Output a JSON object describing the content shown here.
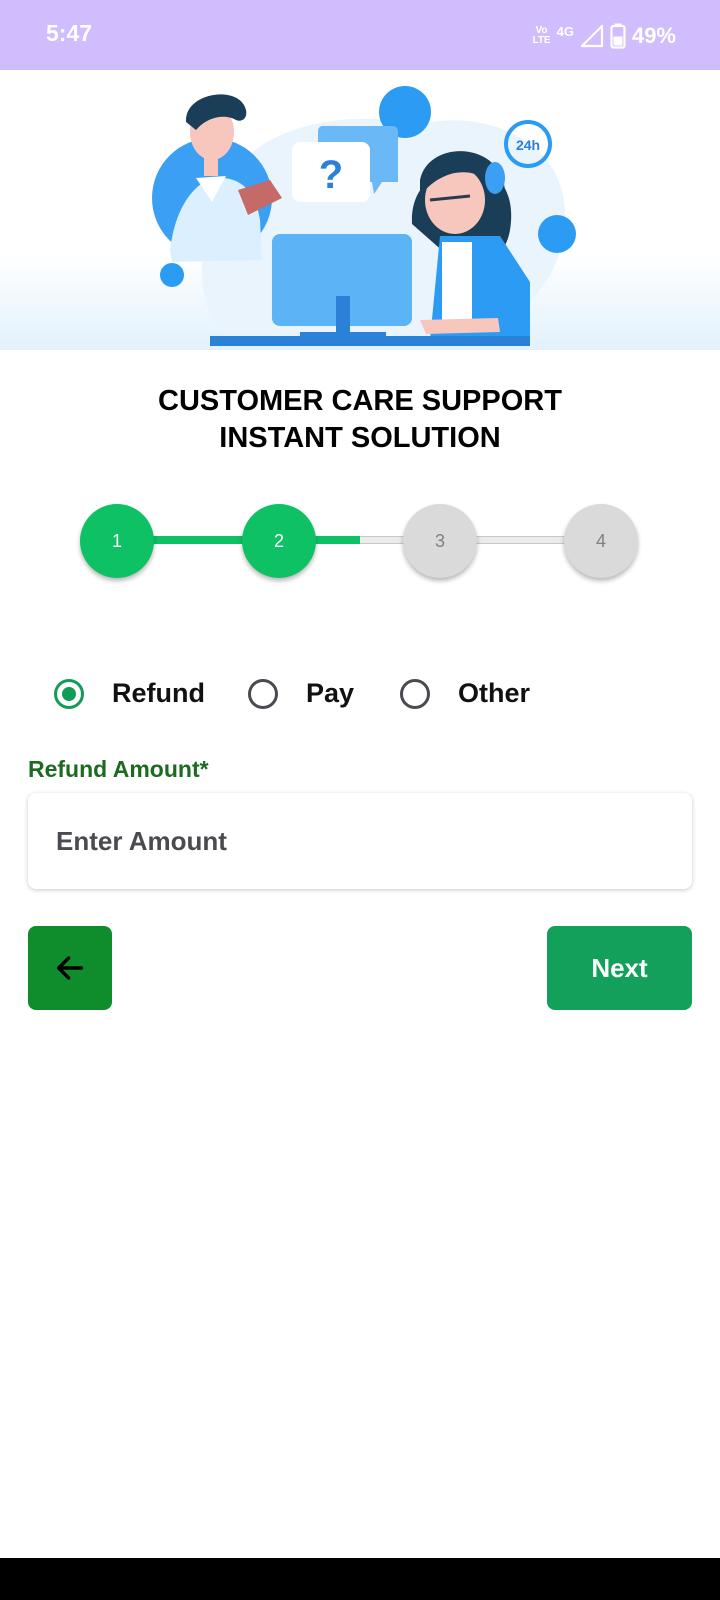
{
  "status": {
    "time": "5:47",
    "volte_top": "Vo",
    "volte_bottom": "LTE",
    "network": "4G",
    "battery": "49%"
  },
  "header": {
    "title_line1": "CUSTOMER CARE SUPPORT",
    "title_line2": "INSTANT SOLUTION"
  },
  "stepper": {
    "current_step": 2,
    "total_steps": 4,
    "steps": [
      "1",
      "2",
      "3",
      "4"
    ]
  },
  "request_type": {
    "options": [
      "Refund",
      "Pay",
      "Other"
    ],
    "selected": "Refund"
  },
  "refund_field": {
    "label": "Refund Amount*",
    "placeholder": "Enter Amount",
    "value": ""
  },
  "actions": {
    "back_icon": "arrow-left-icon",
    "next_label": "Next"
  },
  "colors": {
    "status_bar": "#d0bdfd",
    "accent_green": "#0ec165",
    "button_green": "#12a05a",
    "back_green": "#0f8d2d",
    "label_green": "#1d6b22",
    "step_inactive": "#dadada"
  }
}
